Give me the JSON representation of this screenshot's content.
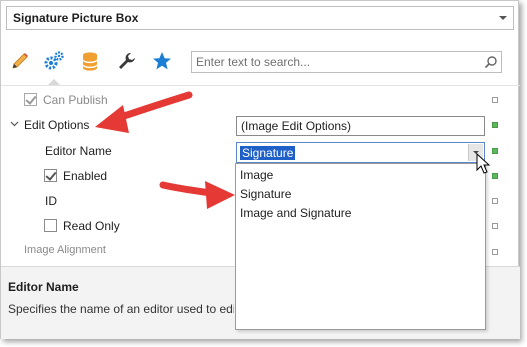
{
  "header": {
    "combo_value": "Signature   Picture Box"
  },
  "toolbar": {
    "icons": [
      "pencil-icon",
      "gears-icon",
      "database-icon",
      "wrench-icon",
      "star-icon"
    ],
    "active": "gears-icon"
  },
  "search": {
    "placeholder": "Enter text to search..."
  },
  "properties": {
    "can_publish": {
      "label": "Can Publish",
      "checked": true
    },
    "edit_options": {
      "label": "Edit Options",
      "value": "(Image Edit Options)"
    },
    "editor_name": {
      "label": "Editor Name",
      "value": "Signature"
    },
    "enabled": {
      "label": "Enabled",
      "checked": true
    },
    "id": {
      "label": "ID"
    },
    "read_only": {
      "label": "Read Only",
      "checked": false
    },
    "image_alignment": {
      "label": "Image Alignment"
    }
  },
  "dropdown": {
    "options": [
      "Image",
      "Signature",
      "Image and Signature"
    ]
  },
  "description": {
    "title": "Editor Name",
    "text": "Specifies the name of an editor used to edit the"
  },
  "colors": {
    "accent_green": "#5db85b",
    "selection_blue": "#1f5fc8",
    "annotation_red": "#e53935"
  }
}
